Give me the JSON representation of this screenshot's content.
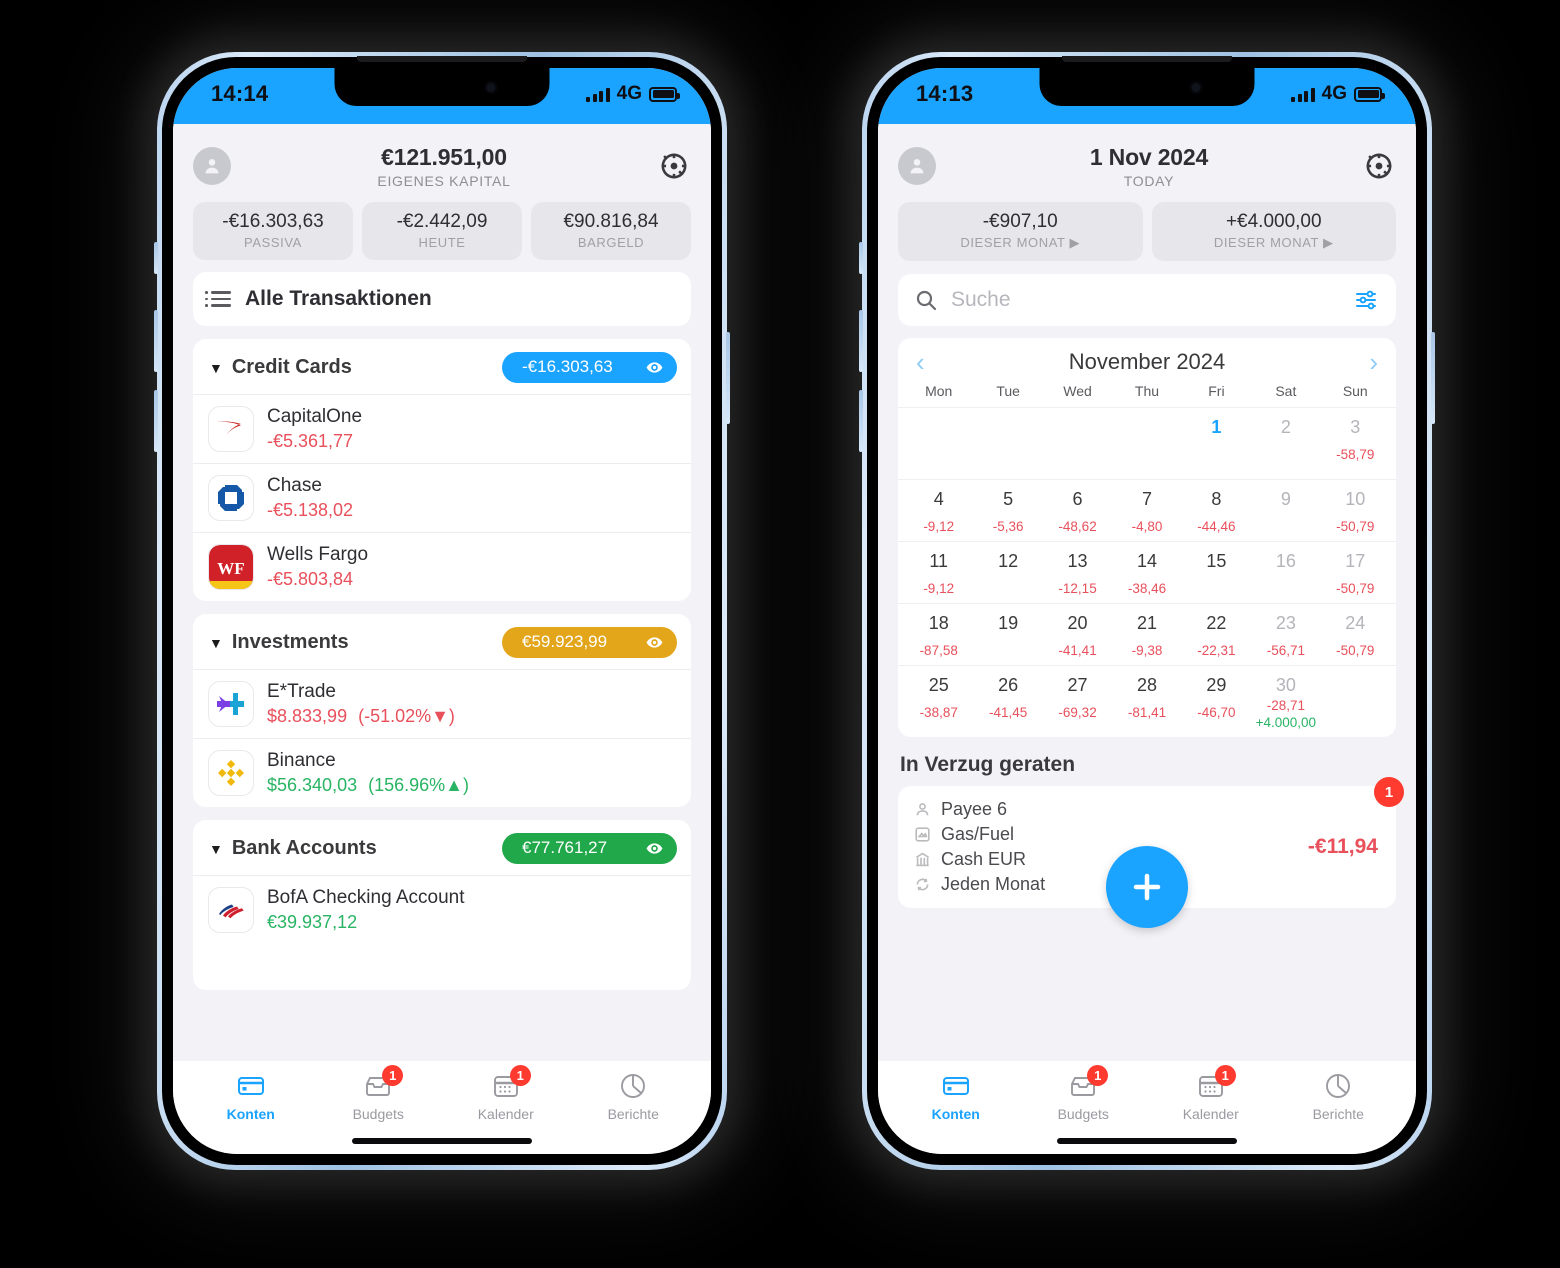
{
  "accounts_phone": {
    "status_bar": {
      "time": "14:14",
      "network": "4G"
    },
    "header": {
      "amount": "€121.951,00",
      "label": "EIGENES KAPITAL",
      "avatar_icon": "person-icon",
      "settings_icon": "gear-icon",
      "chips": [
        {
          "value": "-€16.303,63",
          "label": "PASSIVA"
        },
        {
          "value": "-€2.442,09",
          "label": "HEUTE"
        },
        {
          "value": "€90.816,84",
          "label": "BARGELD"
        }
      ]
    },
    "all_transactions": {
      "label": "Alle Transaktionen",
      "icon": "list-icon"
    },
    "groups": [
      {
        "title": "Credit Cards",
        "total": "-€16.303,63",
        "pill_color": "#1aa3ff",
        "eye_icon": "eye-icon",
        "caret_icon": "caret-down-icon",
        "accounts": [
          {
            "name": "CapitalOne",
            "amount": "-€5.361,77",
            "amount_tone": "neg",
            "change": "",
            "icon": "capitalone-logo-icon"
          },
          {
            "name": "Chase",
            "amount": "-€5.138,02",
            "amount_tone": "neg",
            "change": "",
            "icon": "chase-logo-icon"
          },
          {
            "name": "Wells Fargo",
            "amount": "-€5.803,84",
            "amount_tone": "neg",
            "change": "",
            "icon": "wellsfargo-logo-icon"
          }
        ]
      },
      {
        "title": "Investments",
        "total": "€59.923,99",
        "pill_color": "#e3a51a",
        "eye_icon": "eye-icon",
        "caret_icon": "caret-down-icon",
        "accounts": [
          {
            "name": "E*Trade",
            "amount": "$8.833,99",
            "amount_tone": "neg",
            "change": "(-51.02%▼)",
            "change_tone": "neg",
            "icon": "etrade-logo-icon"
          },
          {
            "name": "Binance",
            "amount": "$56.340,03",
            "amount_tone": "pos",
            "change": "(156.96%▲)",
            "change_tone": "pos",
            "icon": "binance-logo-icon"
          }
        ]
      },
      {
        "title": "Bank Accounts",
        "total": "€77.761,27",
        "pill_color": "#21a84a",
        "eye_icon": "eye-icon",
        "caret_icon": "caret-down-icon",
        "accounts": [
          {
            "name": "BofA Checking Account",
            "amount": "€39.937,12",
            "amount_tone": "pos",
            "change": "",
            "icon": "bankofamerica-logo-icon"
          }
        ]
      }
    ],
    "tabs": [
      {
        "label": "Konten",
        "icon": "card-icon",
        "active": true,
        "badge": ""
      },
      {
        "label": "Budgets",
        "icon": "tray-icon",
        "active": false,
        "badge": "1"
      },
      {
        "label": "Kalender",
        "icon": "calendar-icon",
        "active": false,
        "badge": "1"
      },
      {
        "label": "Berichte",
        "icon": "piechart-icon",
        "active": false,
        "badge": ""
      }
    ]
  },
  "calendar_phone": {
    "status_bar": {
      "time": "14:13",
      "network": "4G"
    },
    "header": {
      "amount": "1 Nov 2024",
      "label": "TODAY",
      "avatar_icon": "person-icon",
      "settings_icon": "gear-icon",
      "chips": [
        {
          "value": "-€907,10",
          "label": "DIESER MONAT ▶"
        },
        {
          "value": "+€4.000,00",
          "label": "DIESER MONAT ▶"
        }
      ]
    },
    "search": {
      "placeholder": "Suche",
      "value": "",
      "icon": "search-icon",
      "filter_icon": "sliders-icon"
    },
    "calendar": {
      "month": "November 2024",
      "prev_icon": "chevron-left-icon",
      "next_icon": "chevron-right-icon",
      "day_names": [
        "Mon",
        "Tue",
        "Wed",
        "Thu",
        "Fri",
        "Sat",
        "Sun"
      ],
      "weeks": [
        [
          {
            "day": "",
            "amount": "",
            "tone": "",
            "style": ""
          },
          {
            "day": "",
            "amount": "",
            "tone": "",
            "style": ""
          },
          {
            "day": "",
            "amount": "",
            "tone": "",
            "style": ""
          },
          {
            "day": "",
            "amount": "",
            "tone": "",
            "style": ""
          },
          {
            "day": "1",
            "amount": "",
            "tone": "",
            "style": "today"
          },
          {
            "day": "2",
            "amount": "",
            "tone": "",
            "style": "dim"
          },
          {
            "day": "3",
            "amount": "-58,79",
            "tone": "neg",
            "style": "dim"
          }
        ],
        [
          {
            "day": "4",
            "amount": "-9,12",
            "tone": "neg",
            "style": ""
          },
          {
            "day": "5",
            "amount": "-5,36",
            "tone": "neg",
            "style": ""
          },
          {
            "day": "6",
            "amount": "-48,62",
            "tone": "neg",
            "style": ""
          },
          {
            "day": "7",
            "amount": "-4,80",
            "tone": "neg",
            "style": ""
          },
          {
            "day": "8",
            "amount": "-44,46",
            "tone": "neg",
            "style": ""
          },
          {
            "day": "9",
            "amount": "",
            "tone": "",
            "style": "dim"
          },
          {
            "day": "10",
            "amount": "-50,79",
            "tone": "neg",
            "style": "dim"
          }
        ],
        [
          {
            "day": "11",
            "amount": "-9,12",
            "tone": "neg",
            "style": ""
          },
          {
            "day": "12",
            "amount": "",
            "tone": "",
            "style": ""
          },
          {
            "day": "13",
            "amount": "-12,15",
            "tone": "neg",
            "style": ""
          },
          {
            "day": "14",
            "amount": "-38,46",
            "tone": "neg",
            "style": ""
          },
          {
            "day": "15",
            "amount": "",
            "tone": "",
            "style": ""
          },
          {
            "day": "16",
            "amount": "",
            "tone": "",
            "style": "dim"
          },
          {
            "day": "17",
            "amount": "-50,79",
            "tone": "neg",
            "style": "dim"
          }
        ],
        [
          {
            "day": "18",
            "amount": "-87,58",
            "tone": "neg",
            "style": ""
          },
          {
            "day": "19",
            "amount": "",
            "tone": "",
            "style": ""
          },
          {
            "day": "20",
            "amount": "-41,41",
            "tone": "neg",
            "style": ""
          },
          {
            "day": "21",
            "amount": "-9,38",
            "tone": "neg",
            "style": ""
          },
          {
            "day": "22",
            "amount": "-22,31",
            "tone": "neg",
            "style": ""
          },
          {
            "day": "23",
            "amount": "-56,71",
            "tone": "neg",
            "style": "dim"
          },
          {
            "day": "24",
            "amount": "-50,79",
            "tone": "neg",
            "style": "dim"
          }
        ],
        [
          {
            "day": "25",
            "amount": "-38,87",
            "tone": "neg",
            "style": ""
          },
          {
            "day": "26",
            "amount": "-41,45",
            "tone": "neg",
            "style": ""
          },
          {
            "day": "27",
            "amount": "-69,32",
            "tone": "neg",
            "style": ""
          },
          {
            "day": "28",
            "amount": "-81,41",
            "tone": "neg",
            "style": ""
          },
          {
            "day": "29",
            "amount": "-46,70",
            "tone": "neg",
            "style": ""
          },
          {
            "day": "30",
            "amount": "-28,71",
            "amount2": "+4.000,00",
            "tone": "neg",
            "tone2": "pos",
            "style": "dim"
          },
          {
            "day": "",
            "amount": "",
            "tone": "",
            "style": ""
          }
        ]
      ]
    },
    "overdue": {
      "title": "In Verzug geraten",
      "badge": "1",
      "amount": "-€11,94",
      "lines": [
        {
          "text": "Payee 6",
          "icon": "person-icon"
        },
        {
          "text": "Gas/Fuel",
          "icon": "category-icon"
        },
        {
          "text": "Cash EUR",
          "icon": "bank-icon"
        },
        {
          "text": "Jeden Monat",
          "icon": "repeat-icon"
        }
      ]
    },
    "fab": {
      "icon": "plus-icon",
      "color": "#1aa3ff"
    },
    "tabs": [
      {
        "label": "Konten",
        "icon": "card-icon",
        "active": true,
        "badge": ""
      },
      {
        "label": "Budgets",
        "icon": "tray-icon",
        "active": false,
        "badge": "1"
      },
      {
        "label": "Kalender",
        "icon": "calendar-icon",
        "active": false,
        "badge": "1"
      },
      {
        "label": "Berichte",
        "icon": "piechart-icon",
        "active": false,
        "badge": ""
      }
    ]
  },
  "colors": {
    "accent": "#1aa3ff",
    "negative": "#e8505b",
    "positive": "#28b463",
    "badge": "#ff3b30",
    "gold": "#e3a51a",
    "green": "#21a84a",
    "page_bg": "#f2f2f7"
  }
}
